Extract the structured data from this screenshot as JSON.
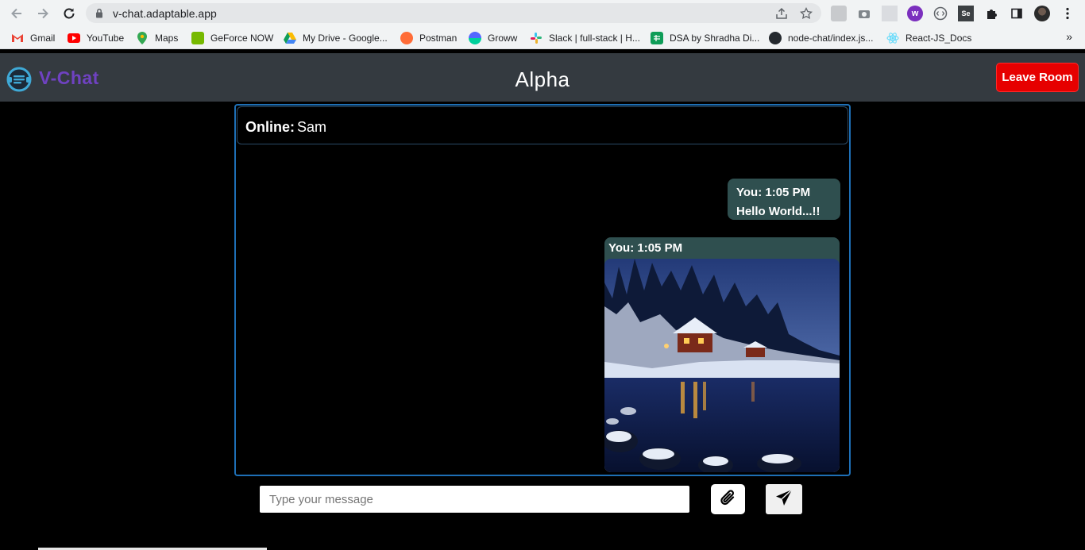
{
  "browser": {
    "url": "v-chat.adaptable.app",
    "bookmarks": [
      {
        "label": "Gmail",
        "icon": "gmail-icon",
        "color": "#ea4335"
      },
      {
        "label": "YouTube",
        "icon": "youtube-icon",
        "color": "#ff0000"
      },
      {
        "label": "Maps",
        "icon": "maps-icon",
        "color": "#34a853"
      },
      {
        "label": "GeForce NOW",
        "icon": "geforce-now-icon",
        "color": "#76b900"
      },
      {
        "label": "My Drive - Google...",
        "icon": "google-drive-icon",
        "color": "#fbbc04"
      },
      {
        "label": "Postman",
        "icon": "postman-icon",
        "color": "#ff6c37"
      },
      {
        "label": "Groww",
        "icon": "groww-icon",
        "color": "#5367ff"
      },
      {
        "label": "Slack | full-stack | H...",
        "icon": "slack-icon",
        "color": "#e01e5a"
      },
      {
        "label": "DSA by Shradha Di...",
        "icon": "google-sheets-icon",
        "color": "#0f9d58"
      },
      {
        "label": "node-chat/index.js...",
        "icon": "github-icon",
        "color": "#24292e"
      },
      {
        "label": "React-JS_Docs",
        "icon": "react-icon",
        "color": "#61dafb"
      }
    ]
  },
  "app": {
    "brand": "V-Chat",
    "room_name": "Alpha",
    "leave_label": "Leave Room",
    "brand_color": "#6f42c1",
    "header_color": "#343a40",
    "leave_color": "#e60000"
  },
  "chat": {
    "online_label": "Online:",
    "online_users": "Sam",
    "messages": [
      {
        "sender_time": "You: 1:05 PM",
        "text": "Hello World...!!",
        "type": "text"
      },
      {
        "sender_time": "You: 1:05 PM",
        "type": "image",
        "image": "snowy-lake-cabin-photo"
      }
    ],
    "bubble_color": "#2f4f4f"
  },
  "composer": {
    "placeholder": "Type your message",
    "attach_icon": "paperclip-icon",
    "send_icon": "send-icon"
  }
}
